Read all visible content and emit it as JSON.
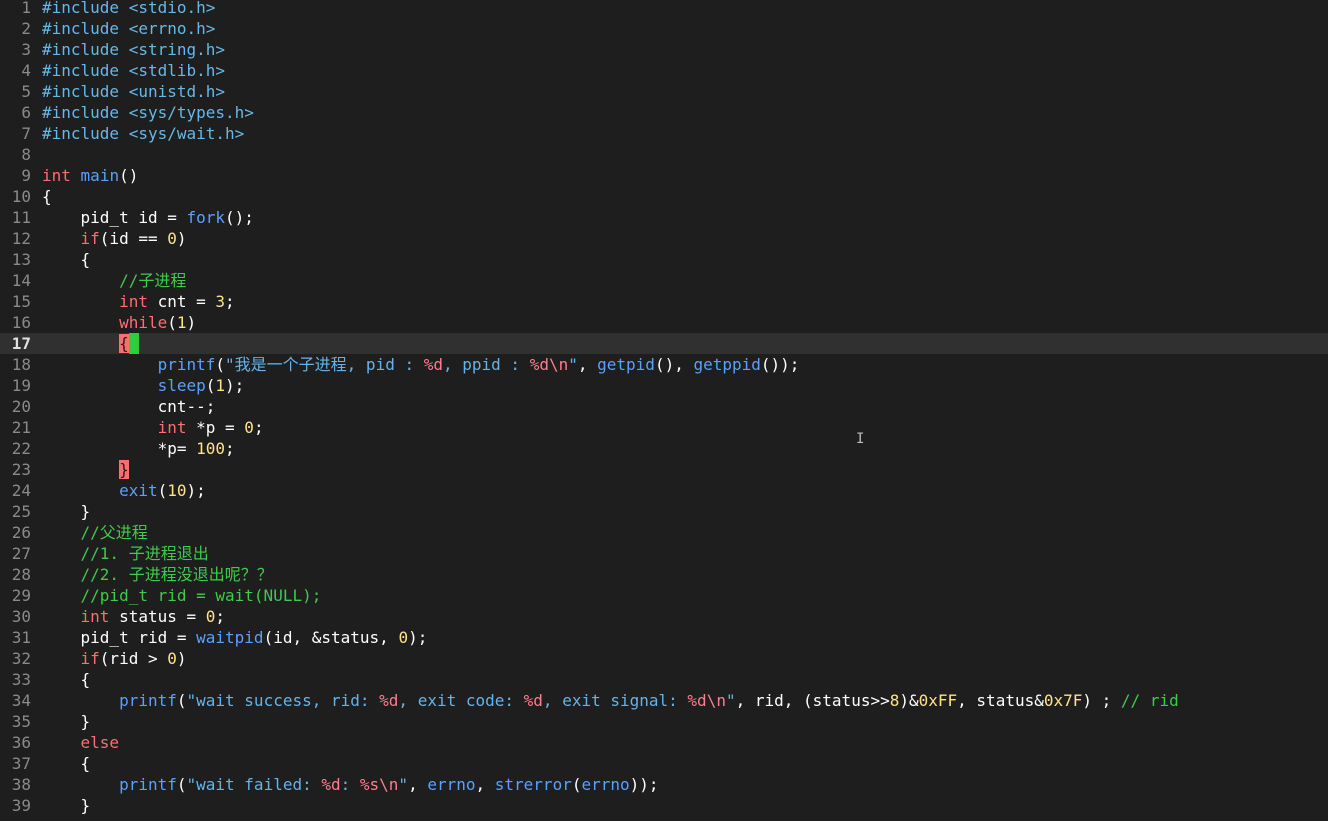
{
  "editor": {
    "current_line": 17,
    "lines": [
      {
        "n": "1",
        "tokens": [
          {
            "c": "pp",
            "t": "#include "
          },
          {
            "c": "inc",
            "t": "<stdio.h>"
          }
        ]
      },
      {
        "n": "2",
        "tokens": [
          {
            "c": "pp",
            "t": "#include "
          },
          {
            "c": "inc",
            "t": "<errno.h>"
          }
        ]
      },
      {
        "n": "3",
        "tokens": [
          {
            "c": "pp",
            "t": "#include "
          },
          {
            "c": "inc",
            "t": "<string.h>"
          }
        ]
      },
      {
        "n": "4",
        "tokens": [
          {
            "c": "pp",
            "t": "#include "
          },
          {
            "c": "inc",
            "t": "<stdlib.h>"
          }
        ]
      },
      {
        "n": "5",
        "tokens": [
          {
            "c": "pp",
            "t": "#include "
          },
          {
            "c": "inc",
            "t": "<unistd.h>"
          }
        ]
      },
      {
        "n": "6",
        "tokens": [
          {
            "c": "pp",
            "t": "#include "
          },
          {
            "c": "inc",
            "t": "<sys/types.h>"
          }
        ]
      },
      {
        "n": "7",
        "tokens": [
          {
            "c": "pp",
            "t": "#include "
          },
          {
            "c": "inc",
            "t": "<sys/wait.h>"
          }
        ]
      },
      {
        "n": "8",
        "tokens": []
      },
      {
        "n": "9",
        "tokens": [
          {
            "c": "kw",
            "t": "int"
          },
          {
            "c": "id",
            "t": " "
          },
          {
            "c": "fn",
            "t": "main"
          },
          {
            "c": "br",
            "t": "()"
          }
        ]
      },
      {
        "n": "10",
        "tokens": [
          {
            "c": "br",
            "t": "{"
          }
        ]
      },
      {
        "n": "11",
        "tokens": [
          {
            "c": "id",
            "t": "    pid_t id = "
          },
          {
            "c": "fn",
            "t": "fork"
          },
          {
            "c": "br",
            "t": "();"
          }
        ]
      },
      {
        "n": "12",
        "tokens": [
          {
            "c": "id",
            "t": "    "
          },
          {
            "c": "kw",
            "t": "if"
          },
          {
            "c": "br",
            "t": "(id == "
          },
          {
            "c": "num",
            "t": "0"
          },
          {
            "c": "br",
            "t": ")"
          }
        ]
      },
      {
        "n": "13",
        "tokens": [
          {
            "c": "br",
            "t": "    {"
          }
        ]
      },
      {
        "n": "14",
        "tokens": [
          {
            "c": "id",
            "t": "        "
          },
          {
            "c": "cm",
            "t": "//子进程"
          }
        ]
      },
      {
        "n": "15",
        "tokens": [
          {
            "c": "id",
            "t": "        "
          },
          {
            "c": "kw",
            "t": "int"
          },
          {
            "c": "id",
            "t": " cnt = "
          },
          {
            "c": "num",
            "t": "3"
          },
          {
            "c": "br",
            "t": ";"
          }
        ]
      },
      {
        "n": "16",
        "tokens": [
          {
            "c": "id",
            "t": "        "
          },
          {
            "c": "kw",
            "t": "while"
          },
          {
            "c": "br",
            "t": "("
          },
          {
            "c": "num",
            "t": "1"
          },
          {
            "c": "br",
            "t": ")"
          }
        ]
      },
      {
        "n": "17",
        "tokens": [
          {
            "c": "id",
            "t": "        "
          },
          {
            "c": "match",
            "t": "{"
          },
          {
            "c": "cursor",
            "t": " "
          }
        ]
      },
      {
        "n": "18",
        "tokens": [
          {
            "c": "id",
            "t": "            "
          },
          {
            "c": "fn",
            "t": "printf"
          },
          {
            "c": "br",
            "t": "("
          },
          {
            "c": "str",
            "t": "\"我是一个子进程, pid : "
          },
          {
            "c": "fmt",
            "t": "%d"
          },
          {
            "c": "str",
            "t": ", ppid : "
          },
          {
            "c": "fmt",
            "t": "%d\\n"
          },
          {
            "c": "str",
            "t": "\""
          },
          {
            "c": "id",
            "t": ", "
          },
          {
            "c": "fn",
            "t": "getpid"
          },
          {
            "c": "br",
            "t": "()"
          },
          {
            "c": "id",
            "t": ", "
          },
          {
            "c": "fn",
            "t": "getppid"
          },
          {
            "c": "br",
            "t": "());"
          }
        ]
      },
      {
        "n": "19",
        "tokens": [
          {
            "c": "id",
            "t": "            "
          },
          {
            "c": "fn",
            "t": "sleep"
          },
          {
            "c": "br",
            "t": "("
          },
          {
            "c": "num",
            "t": "1"
          },
          {
            "c": "br",
            "t": ");"
          }
        ]
      },
      {
        "n": "20",
        "tokens": [
          {
            "c": "id",
            "t": "            cnt--;"
          }
        ]
      },
      {
        "n": "21",
        "tokens": [
          {
            "c": "id",
            "t": "            "
          },
          {
            "c": "kw",
            "t": "int"
          },
          {
            "c": "id",
            "t": " *p = "
          },
          {
            "c": "num",
            "t": "0"
          },
          {
            "c": "br",
            "t": ";"
          }
        ]
      },
      {
        "n": "22",
        "tokens": [
          {
            "c": "id",
            "t": "            *p= "
          },
          {
            "c": "num",
            "t": "100"
          },
          {
            "c": "br",
            "t": ";"
          }
        ]
      },
      {
        "n": "23",
        "tokens": [
          {
            "c": "id",
            "t": "        "
          },
          {
            "c": "match",
            "t": "}"
          }
        ]
      },
      {
        "n": "24",
        "tokens": [
          {
            "c": "id",
            "t": "        "
          },
          {
            "c": "fn",
            "t": "exit"
          },
          {
            "c": "br",
            "t": "("
          },
          {
            "c": "num",
            "t": "10"
          },
          {
            "c": "br",
            "t": ");"
          }
        ]
      },
      {
        "n": "25",
        "tokens": [
          {
            "c": "br",
            "t": "    }"
          }
        ]
      },
      {
        "n": "26",
        "tokens": [
          {
            "c": "id",
            "t": "    "
          },
          {
            "c": "cm",
            "t": "//父进程"
          }
        ]
      },
      {
        "n": "27",
        "tokens": [
          {
            "c": "id",
            "t": "    "
          },
          {
            "c": "cm",
            "t": "//1. 子进程退出"
          }
        ]
      },
      {
        "n": "28",
        "tokens": [
          {
            "c": "id",
            "t": "    "
          },
          {
            "c": "cm",
            "t": "//2. 子进程没退出呢？？"
          }
        ]
      },
      {
        "n": "29",
        "tokens": [
          {
            "c": "id",
            "t": "    "
          },
          {
            "c": "cm",
            "t": "//pid_t rid = wait(NULL);"
          }
        ]
      },
      {
        "n": "30",
        "tokens": [
          {
            "c": "id",
            "t": "    "
          },
          {
            "c": "kw",
            "t": "int"
          },
          {
            "c": "id",
            "t": " status = "
          },
          {
            "c": "num",
            "t": "0"
          },
          {
            "c": "br",
            "t": ";"
          }
        ]
      },
      {
        "n": "31",
        "tokens": [
          {
            "c": "id",
            "t": "    pid_t rid = "
          },
          {
            "c": "fn",
            "t": "waitpid"
          },
          {
            "c": "br",
            "t": "("
          },
          {
            "c": "id",
            "t": "id, &status, "
          },
          {
            "c": "num",
            "t": "0"
          },
          {
            "c": "br",
            "t": ");"
          }
        ]
      },
      {
        "n": "32",
        "tokens": [
          {
            "c": "id",
            "t": "    "
          },
          {
            "c": "kw",
            "t": "if"
          },
          {
            "c": "br",
            "t": "(rid > "
          },
          {
            "c": "num",
            "t": "0"
          },
          {
            "c": "br",
            "t": ")"
          }
        ]
      },
      {
        "n": "33",
        "tokens": [
          {
            "c": "br",
            "t": "    {"
          }
        ]
      },
      {
        "n": "34",
        "tokens": [
          {
            "c": "id",
            "t": "        "
          },
          {
            "c": "fn",
            "t": "printf"
          },
          {
            "c": "br",
            "t": "("
          },
          {
            "c": "str",
            "t": "\"wait success, rid: "
          },
          {
            "c": "fmt",
            "t": "%d"
          },
          {
            "c": "str",
            "t": ", exit code: "
          },
          {
            "c": "fmt",
            "t": "%d"
          },
          {
            "c": "str",
            "t": ", exit signal: "
          },
          {
            "c": "fmt",
            "t": "%d\\n"
          },
          {
            "c": "str",
            "t": "\""
          },
          {
            "c": "id",
            "t": ", rid, (status>>"
          },
          {
            "c": "num",
            "t": "8"
          },
          {
            "c": "id",
            "t": ")&"
          },
          {
            "c": "num",
            "t": "0xFF"
          },
          {
            "c": "id",
            "t": ", status&"
          },
          {
            "c": "num",
            "t": "0x7F"
          },
          {
            "c": "id",
            "t": ") ; "
          },
          {
            "c": "cm",
            "t": "// rid"
          }
        ]
      },
      {
        "n": "35",
        "tokens": [
          {
            "c": "br",
            "t": "    }"
          }
        ]
      },
      {
        "n": "36",
        "tokens": [
          {
            "c": "id",
            "t": "    "
          },
          {
            "c": "kw",
            "t": "else"
          }
        ]
      },
      {
        "n": "37",
        "tokens": [
          {
            "c": "br",
            "t": "    {"
          }
        ]
      },
      {
        "n": "38",
        "tokens": [
          {
            "c": "id",
            "t": "        "
          },
          {
            "c": "fn",
            "t": "printf"
          },
          {
            "c": "br",
            "t": "("
          },
          {
            "c": "str",
            "t": "\"wait failed: "
          },
          {
            "c": "fmt",
            "t": "%d"
          },
          {
            "c": "str",
            "t": ": "
          },
          {
            "c": "fmt",
            "t": "%s\\n"
          },
          {
            "c": "str",
            "t": "\""
          },
          {
            "c": "id",
            "t": ", "
          },
          {
            "c": "fn",
            "t": "errno"
          },
          {
            "c": "id",
            "t": ", "
          },
          {
            "c": "fn",
            "t": "strerror"
          },
          {
            "c": "br",
            "t": "("
          },
          {
            "c": "fn",
            "t": "errno"
          },
          {
            "c": "br",
            "t": "));"
          }
        ]
      },
      {
        "n": "39",
        "tokens": [
          {
            "c": "br",
            "t": "    }"
          }
        ]
      }
    ]
  },
  "colors": {
    "background": "#1e1e1e",
    "current_line": "#303030",
    "keyword": "#ff6e6e",
    "function": "#5aa0ff",
    "number": "#ffe28a",
    "string": "#67b2e6",
    "comment": "#3fca4a",
    "cursor": "#2ecc40"
  },
  "icons": {
    "mouse_cursor": "text-ibeam-icon"
  }
}
